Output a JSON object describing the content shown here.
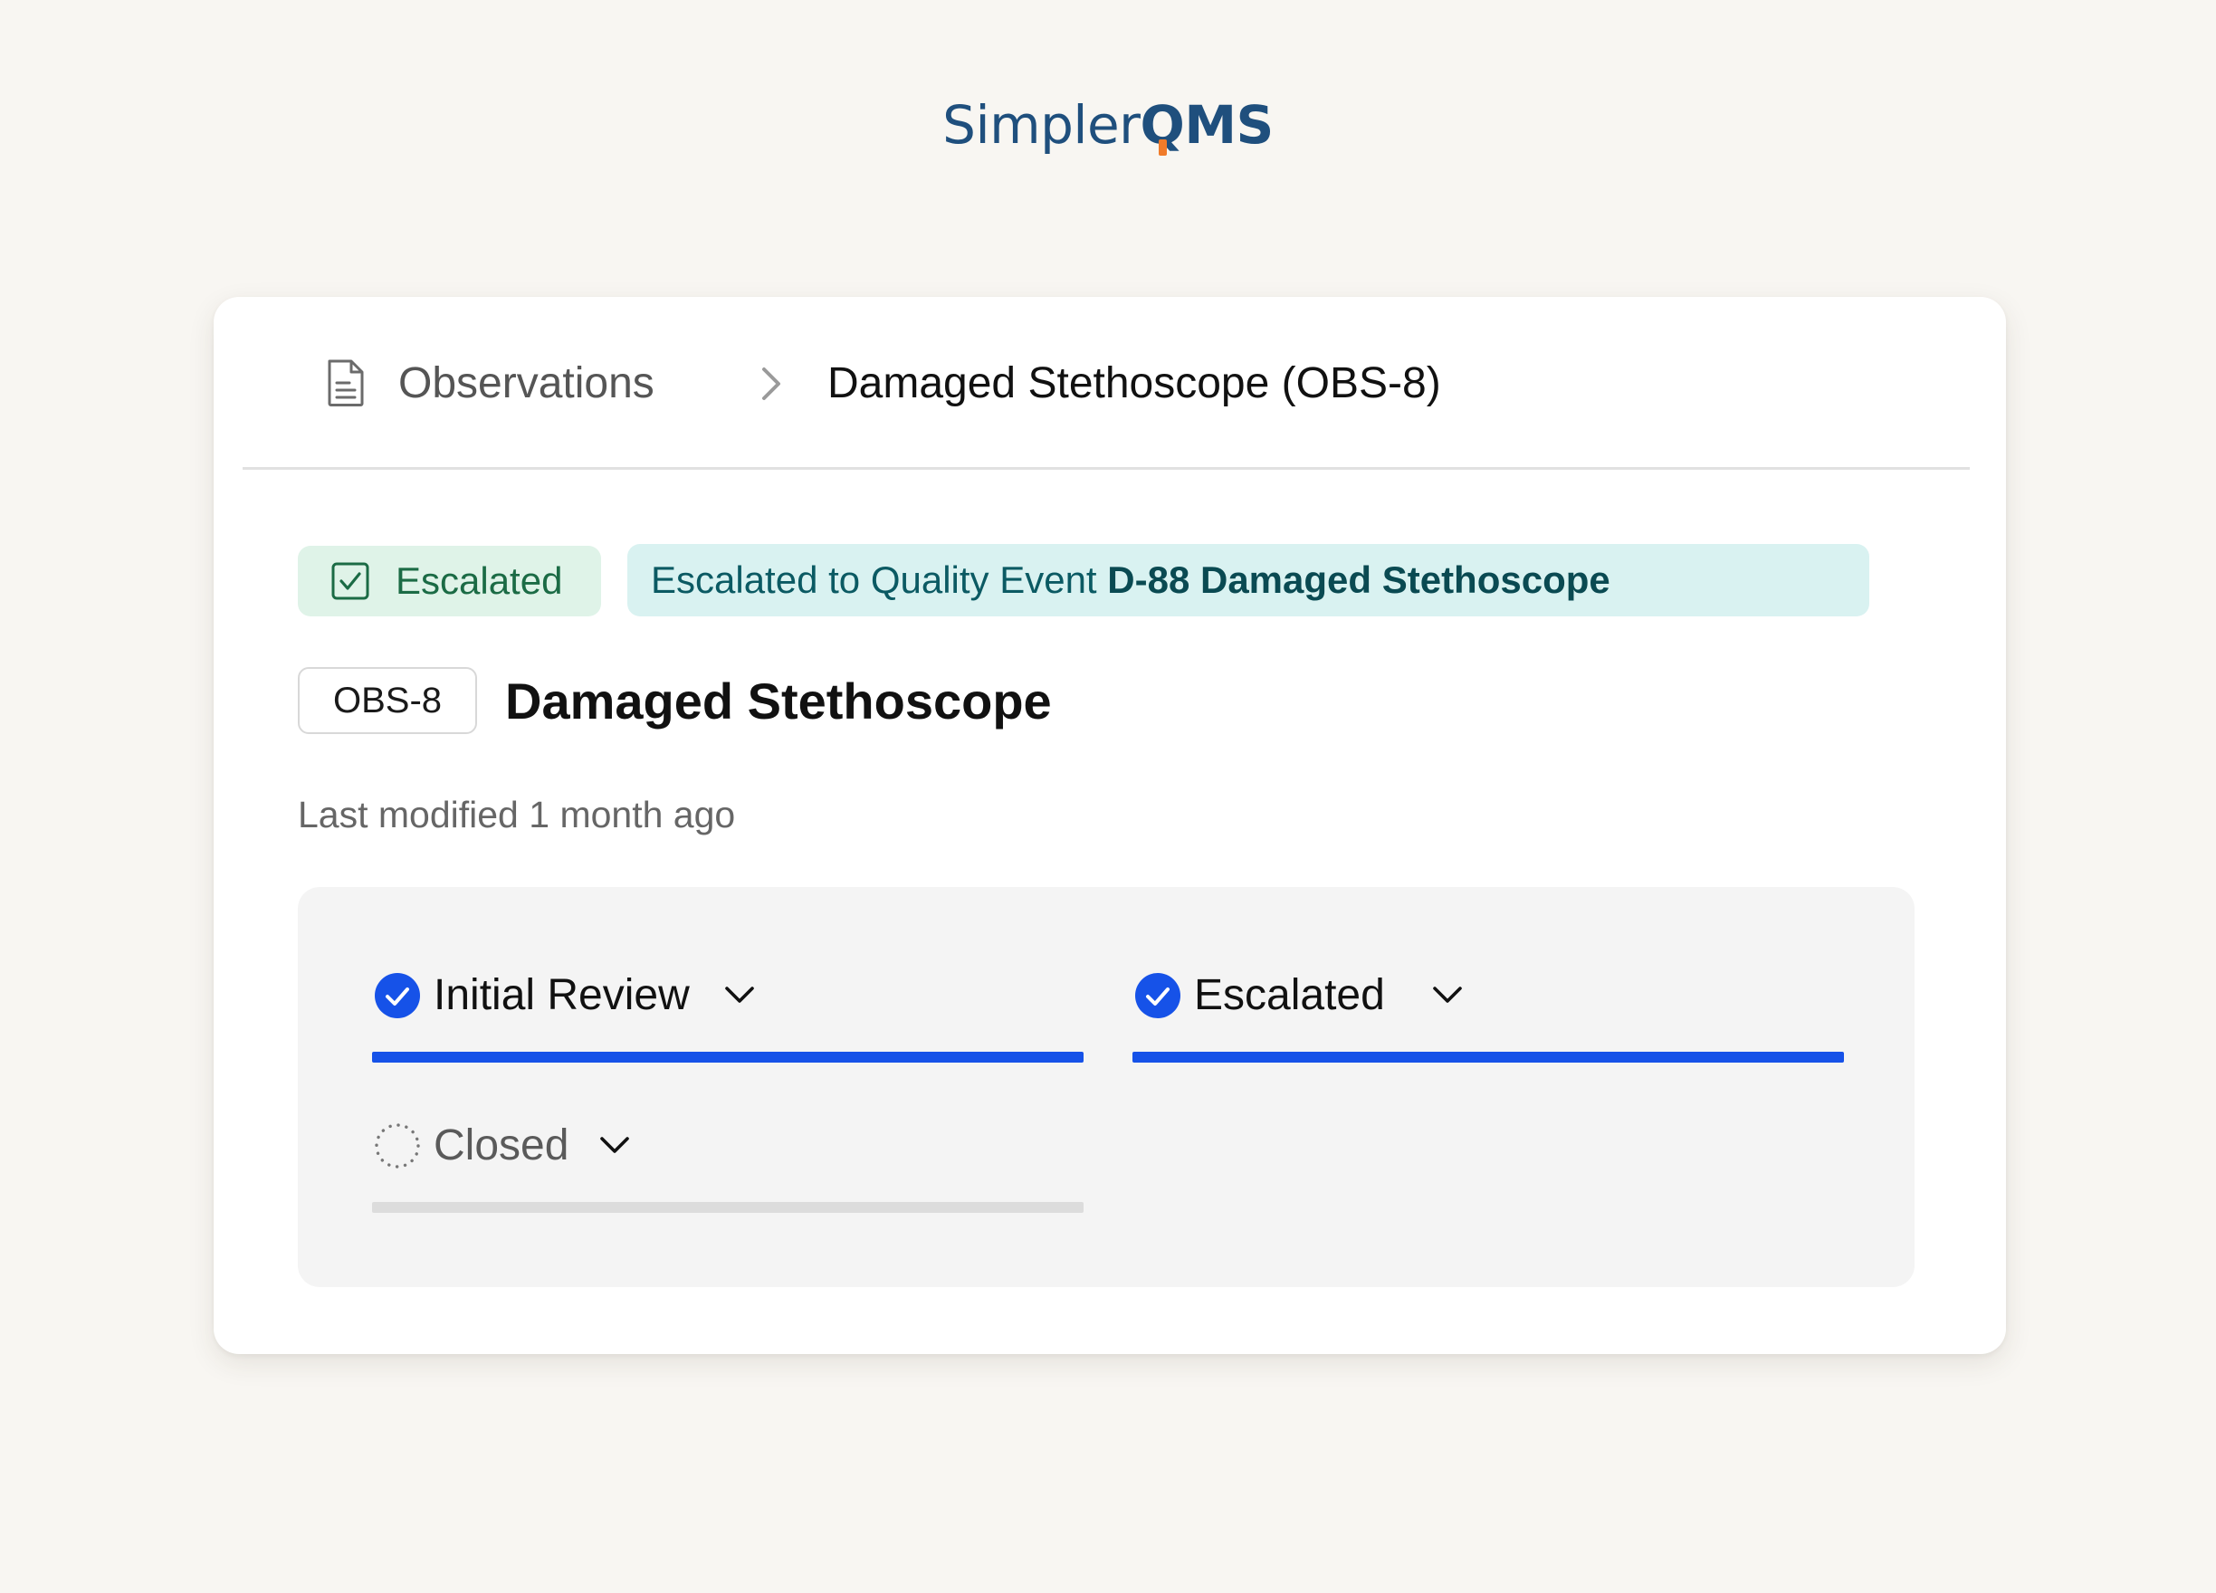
{
  "logo": {
    "simpler": "Simpler",
    "q": "Q",
    "ms": "MS",
    "accent_color": "#f07b2a",
    "brand_color": "#1f4f7d"
  },
  "breadcrumb": {
    "icon": "document-icon",
    "root_label": "Observations",
    "separator_icon": "chevron-right-icon",
    "current_label": "Damaged Stethoscope (OBS-8)"
  },
  "status": {
    "icon": "checkbox-checked-icon",
    "label": "Escalated",
    "color": "#1b6b45",
    "background": "#dff3e8"
  },
  "escalation": {
    "prefix": "Escalated to Quality Event ",
    "event_ref": "D-88 Damaged Stethoscope",
    "color": "#0b5a63",
    "background": "#d9f2f1"
  },
  "record": {
    "id": "OBS-8",
    "title": "Damaged Stethoscope",
    "last_modified": "Last modified 1 month ago"
  },
  "workflow": {
    "accent_color": "#1652e8",
    "stages": [
      {
        "label": "Initial Review",
        "state": "done",
        "icon": "check-circle-icon",
        "progress": 1.0
      },
      {
        "label": "Escalated",
        "state": "done",
        "icon": "check-circle-icon",
        "progress": 1.0
      },
      {
        "label": "Closed",
        "state": "pending",
        "icon": "dotted-circle-icon",
        "progress": 0.0
      }
    ]
  }
}
